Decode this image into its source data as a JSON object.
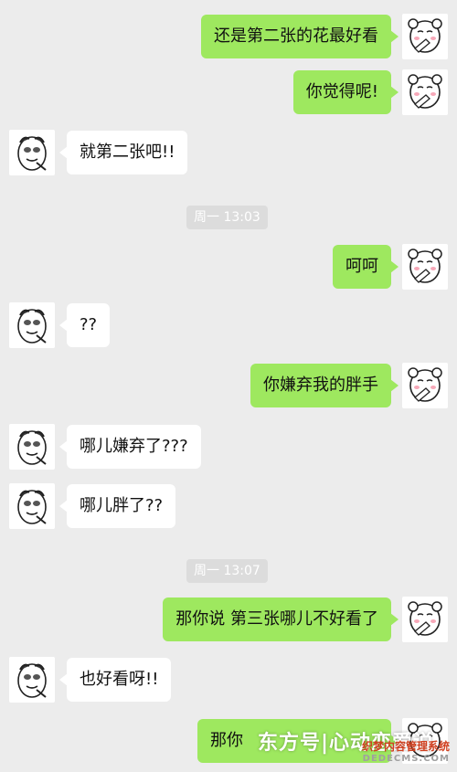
{
  "messages": [
    {
      "text": "还是第二张的花最好看"
    },
    {
      "text": "你觉得呢!"
    },
    {
      "text": "就第二张吧!!"
    },
    {
      "text": "呵呵"
    },
    {
      "text": "??"
    },
    {
      "text": "你嫌弃我的胖手"
    },
    {
      "text": "哪儿嫌弃了???"
    },
    {
      "text": "哪儿胖了??"
    },
    {
      "text": "那你说 第三张哪儿不好看了"
    },
    {
      "text": "也好看呀!!"
    },
    {
      "text": "那你"
    }
  ],
  "timestamps": [
    {
      "text": "周一 13:03"
    },
    {
      "text": "周一 13:07"
    }
  ],
  "watermark": {
    "text": "东方号|心动恋爱说"
  },
  "site_logo": {
    "line1": "织梦内容管理系统",
    "line2": "DEDECMS.COM"
  }
}
